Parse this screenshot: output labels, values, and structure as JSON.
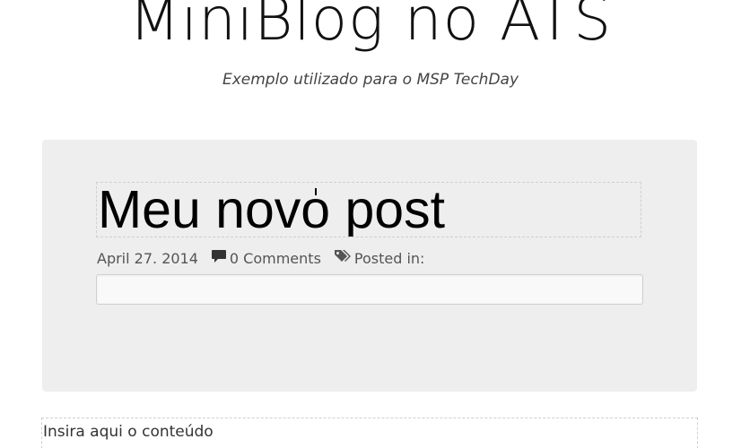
{
  "header": {
    "title": "MiniBlog no ATS",
    "subtitle": "Exemplo utilizado para o MSP TechDay"
  },
  "post": {
    "title": "Meu novo post",
    "date": "April 27. 2014",
    "comments_label": "0 Comments",
    "posted_in_label": "Posted in:",
    "tags_value": ""
  },
  "content": {
    "placeholder_text": "Insira aqui o conteúdo"
  },
  "icons": {
    "comment": "comment-icon",
    "tags": "tags-icon"
  },
  "colors": {
    "card_background": "#eeeeee",
    "text_dark": "#111111",
    "meta_text": "#555555"
  }
}
